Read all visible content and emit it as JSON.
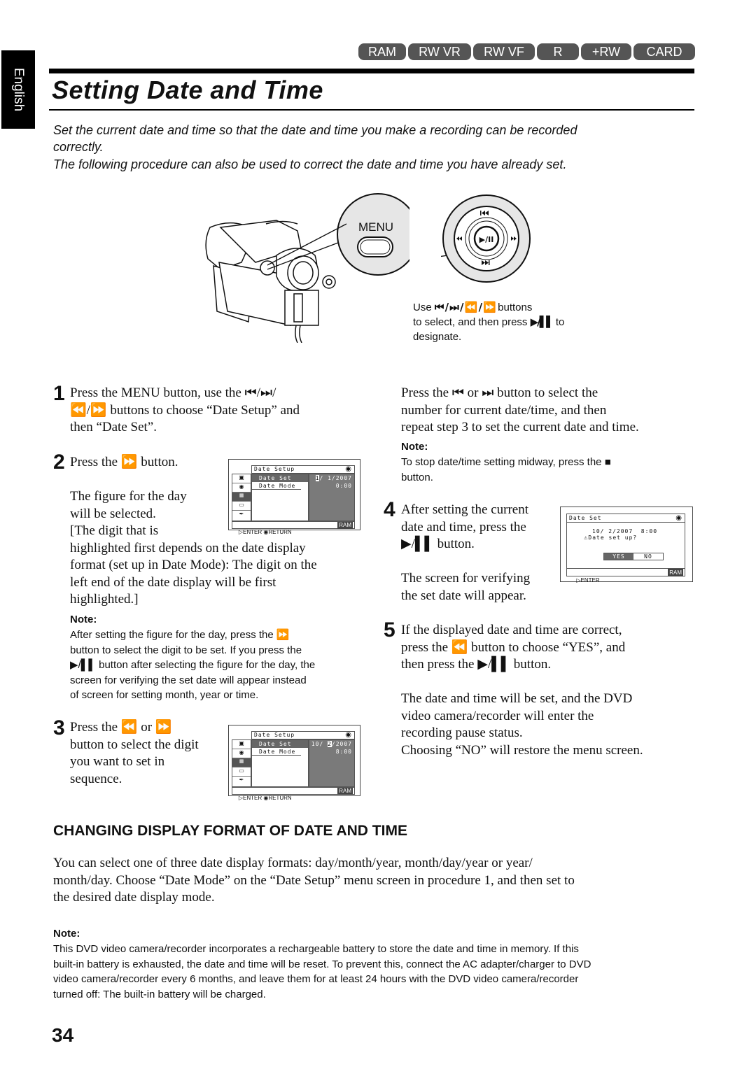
{
  "side_tab": {
    "label": "English"
  },
  "media_badges": [
    "RAM",
    "RW VR",
    "RW VF",
    "R",
    "+RW",
    "CARD"
  ],
  "title": "Setting Date and Time",
  "intro": {
    "line1": "Set the current date and time so that the date and time you make a recording can be recorded",
    "line2": "correctly.",
    "line3": "The following procedure can also be used to correct the date and time you have already set."
  },
  "illustration": {
    "menu_label": "MENU",
    "dial_center": "▶/II",
    "caption": {
      "line1_pre": "Use ",
      "line1_post": " buttons",
      "line1_glyphs": "⏮ / ⏭ / ⏪ / ⏩",
      "line2_pre": "to select, and then press ",
      "line2_glyph": "▶/▌▌",
      "line2_post": " to",
      "line3": "designate."
    }
  },
  "steps": {
    "s1": {
      "num": "1",
      "line1": "Press the MENU button, use the ⏮/⏭/",
      "line2": "⏪/⏩ buttons to choose “Date Setup” and",
      "line3": "then “Date Set”."
    },
    "s2": {
      "num": "2",
      "line1": "Press the ⏩ button.",
      "para1": "The figure for the day",
      "para2": "will be selected.",
      "para3": "[The digit that is",
      "para4": "highlighted first depends on the date display",
      "para5": "format (set up in Date Mode): The digit on the",
      "para6": "left end of the date display will be first",
      "para7": "highlighted.]",
      "note_label": "Note:",
      "note1": "After setting the figure for the day, press the ⏩",
      "note2": "button to select the digit to be set. If you press the",
      "note3": "▶/▌▌ button after selecting the figure for the day, the",
      "note4": "screen for verifying the set date will appear instead",
      "note5": "of screen for setting month, year or time."
    },
    "s3": {
      "num": "3",
      "line1": "Press the ⏪ or ⏩",
      "line2": "button to select the digit",
      "line3": "you want to set in",
      "line4": "sequence.",
      "cont1": "Press the ⏮ or ⏭ button to select the",
      "cont2": "number for current date/time, and then",
      "cont3": "repeat step 3 to set the current date and time.",
      "note_label": "Note:",
      "note1": "To stop date/time setting midway, press the ■",
      "note2": "button."
    },
    "s4": {
      "num": "4",
      "line1": "After setting the current",
      "line2": "date and time, press the",
      "line3": "▶/▌▌ button.",
      "para1": "The screen for verifying",
      "para2": "the set date will appear."
    },
    "s5": {
      "num": "5",
      "line1": "If the displayed date and time are correct,",
      "line2": "press the ⏪ button to choose “YES”, and",
      "line3": "then press the ▶/▌▌ button.",
      "para1": "The date and time will be set, and the DVD",
      "para2": "video camera/recorder will enter the",
      "para3": "recording pause status.",
      "para4": "Choosing “NO” will restore the menu screen."
    }
  },
  "screens": {
    "screen_a": {
      "header": "Date Setup",
      "items": [
        "Date Set",
        "Date Mode"
      ],
      "date": "1/ 1/2007",
      "highlight": "1",
      "date_rest": "/ 1/2007",
      "time": "0:00",
      "footer_enter": "ENTER",
      "footer_return": "RETURN",
      "disc": "RAM"
    },
    "screen_b": {
      "header": "Date Setup",
      "items": [
        "Date Set",
        "Date Mode"
      ],
      "date_pre": "10/ ",
      "highlight": "2",
      "date_rest": "/2007",
      "time": "8:00",
      "footer_enter": "ENTER",
      "footer_return": "RETURN",
      "disc": "RAM"
    },
    "screen_c": {
      "header": "Date Set",
      "datetime": "10/ 2/2007  8:00",
      "question": "Date set up?",
      "yes": "YES",
      "no": "NO",
      "footer_enter": "ENTER",
      "disc": "RAM"
    }
  },
  "section": {
    "heading": "CHANGING DISPLAY FORMAT OF DATE AND TIME",
    "line1": "You can select one of three date display formats: day/month/year, month/day/year or year/",
    "line2": "month/day. Choose “Date Mode” on the “Date Setup” menu screen in procedure 1, and then set to",
    "line3": "the desired date display mode.",
    "note_label": "Note:",
    "note1": "This DVD video camera/recorder incorporates a rechargeable battery to store the date and time in memory. If this",
    "note2": "built-in battery is exhausted, the date and time will be reset. To prevent this, connect the AC adapter/charger to DVD",
    "note3": "video camera/recorder every 6 months, and leave them for at least 24 hours with the DVD video camera/recorder",
    "note4": "turned off: The built-in battery will be charged."
  },
  "page_number": "34"
}
